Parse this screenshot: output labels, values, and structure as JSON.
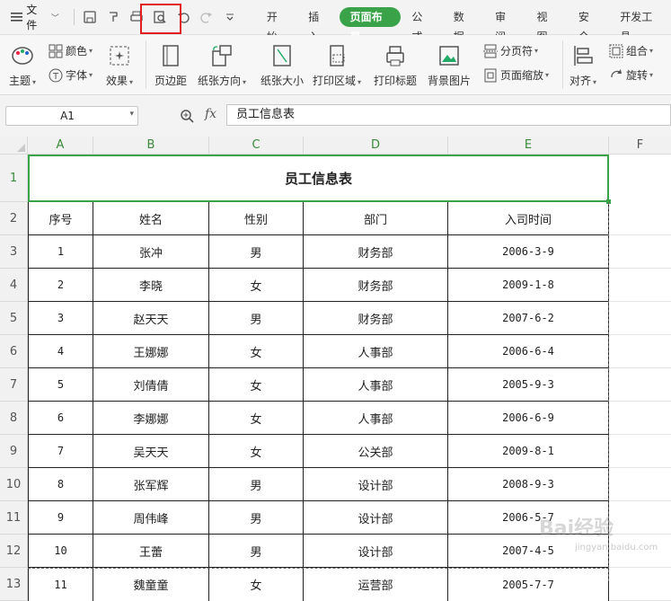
{
  "menu": {
    "file_label": "文件",
    "tabs": [
      "开始",
      "插入",
      "页面布局",
      "公式",
      "数据",
      "审阅",
      "视图",
      "安全",
      "开发工具"
    ],
    "active_tab": "页面布局"
  },
  "ribbon": {
    "theme": "主题",
    "colors": "颜色",
    "fonts": "字体",
    "effects": "效果",
    "margins": "页边距",
    "orientation": "纸张方向",
    "size": "纸张大小",
    "print_area": "打印区域",
    "print_titles": "打印标题",
    "background": "背景图片",
    "breaks": "分页符",
    "scaling": "页面缩放",
    "align": "对齐",
    "group": "组合",
    "rotate": "旋转"
  },
  "formula_bar": {
    "cell_ref": "A1",
    "fx": "fx",
    "value": "员工信息表"
  },
  "sheet": {
    "columns": [
      "A",
      "B",
      "C",
      "D",
      "E",
      "F"
    ],
    "row_numbers": [
      "1",
      "2",
      "3",
      "4",
      "5",
      "6",
      "7",
      "8",
      "9",
      "10",
      "11",
      "12",
      "13"
    ],
    "title": "员工信息表",
    "headers": [
      "序号",
      "姓名",
      "性别",
      "部门",
      "入司时间"
    ],
    "rows": [
      [
        "1",
        "张冲",
        "男",
        "财务部",
        "2006-3-9"
      ],
      [
        "2",
        "李晓",
        "女",
        "财务部",
        "2009-1-8"
      ],
      [
        "3",
        "赵天天",
        "男",
        "财务部",
        "2007-6-2"
      ],
      [
        "4",
        "王娜娜",
        "女",
        "人事部",
        "2006-6-4"
      ],
      [
        "5",
        "刘倩倩",
        "女",
        "人事部",
        "2005-9-3"
      ],
      [
        "6",
        "李娜娜",
        "女",
        "人事部",
        "2006-6-9"
      ],
      [
        "7",
        "吴天天",
        "女",
        "公关部",
        "2009-8-1"
      ],
      [
        "8",
        "张军辉",
        "男",
        "设计部",
        "2008-9-3"
      ],
      [
        "9",
        "周伟峰",
        "男",
        "设计部",
        "2006-5-7"
      ],
      [
        "10",
        "王蕾",
        "男",
        "设计部",
        "2007-4-5"
      ],
      [
        "11",
        "魏童童",
        "女",
        "运营部",
        "2005-7-7"
      ]
    ]
  },
  "watermark": {
    "main": "Bai经验",
    "sub": "jingyan.baidu.com"
  }
}
